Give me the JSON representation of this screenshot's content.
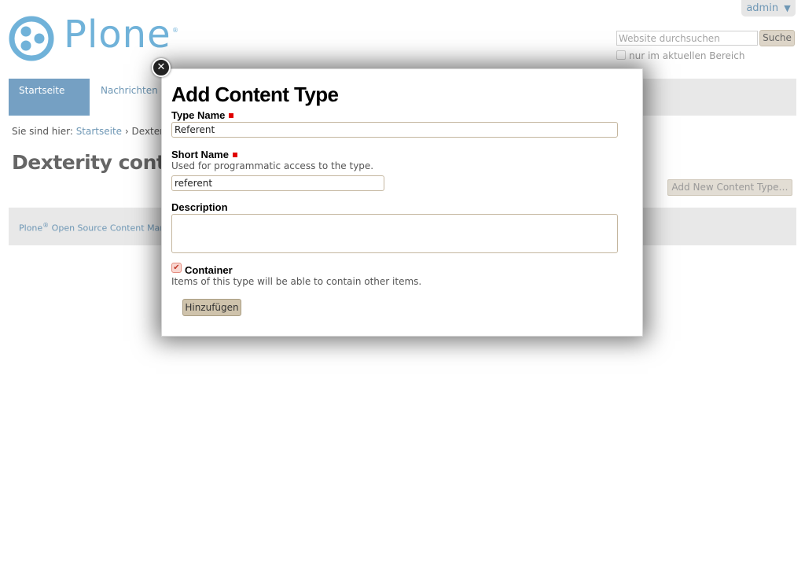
{
  "header": {
    "user_menu_label": "admin",
    "user_menu_caret": "▼",
    "logo_text": "Plone",
    "logo_reg": "®",
    "logo_color": "#70b2d9"
  },
  "search": {
    "placeholder": "Website durchsuchen",
    "button_label": "Suche",
    "scope_label": "nur im aktuellen Bereich"
  },
  "nav": {
    "tabs": [
      {
        "label": "Startseite",
        "active": true
      },
      {
        "label": "Nachrichten",
        "active": false
      }
    ]
  },
  "breadcrumb": {
    "prefix": "Sie sind hier:",
    "home": "Startseite",
    "separator": "›",
    "current": "Dexterity"
  },
  "page": {
    "title": "Dexterity content",
    "add_button_label": "Add New Content Type…"
  },
  "footer": {
    "brand": "Plone",
    "reg": "®",
    "text": "Open Source Content Man"
  },
  "dialog": {
    "close_icon": "close-icon",
    "title": "Add Content Type",
    "type_name": {
      "label": "Type Name",
      "value": "Referent"
    },
    "short_name": {
      "label": "Short Name",
      "help": "Used for programmatic access to the type.",
      "value": "referent"
    },
    "description": {
      "label": "Description",
      "value": ""
    },
    "container": {
      "label": "Container",
      "help": "Items of this type will be able to contain other items.",
      "checked": true
    },
    "submit_label": "Hinzufügen"
  },
  "colors": {
    "accent": "#75a0c3",
    "link": "#6e97b5",
    "required": "#e00000"
  }
}
